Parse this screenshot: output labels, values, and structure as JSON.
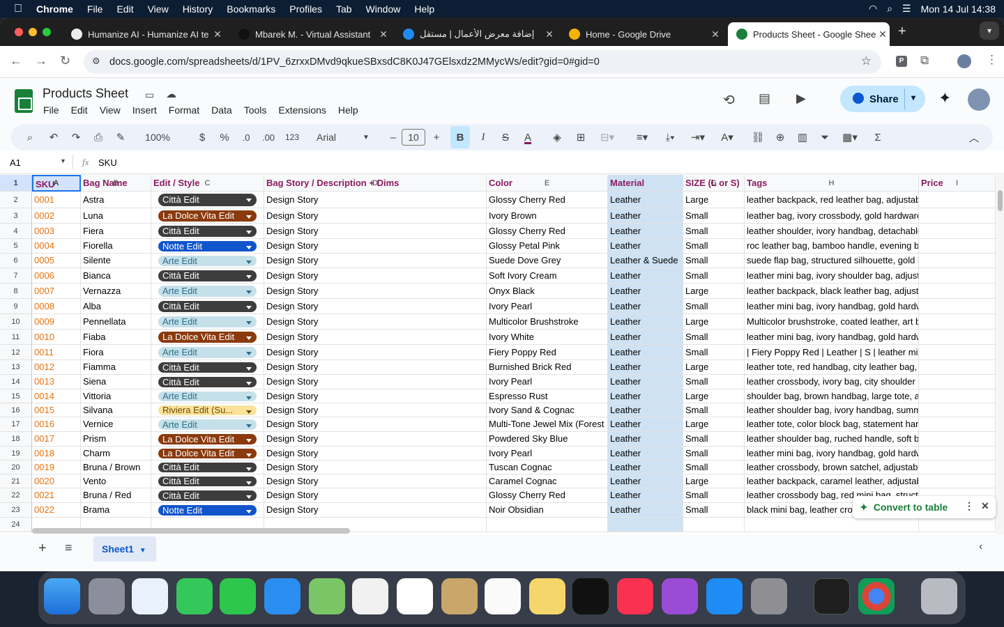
{
  "macos": {
    "menus": [
      "Chrome",
      "File",
      "Edit",
      "View",
      "History",
      "Bookmarks",
      "Profiles",
      "Tab",
      "Window",
      "Help"
    ],
    "clock": "Mon 14 Jul  14:38"
  },
  "browser": {
    "tabs": [
      {
        "title": "Humanize AI - Humanize AI te",
        "active": false
      },
      {
        "title": "Mbarek M. - Virtual Assistant",
        "active": false
      },
      {
        "title": "إضافة معرض الأعمال | مستقل",
        "active": false
      },
      {
        "title": "Home - Google Drive",
        "active": false
      },
      {
        "title": "Products Sheet - Google Shee",
        "active": true
      }
    ],
    "url": "docs.google.com/spreadsheets/d/1PV_6zrxxDMvd9qkueSBxsdC8K0J47GElsxdz2MMycWs/edit?gid=0#gid=0"
  },
  "sheets": {
    "title": "Products Sheet",
    "menu": [
      "File",
      "Edit",
      "View",
      "Insert",
      "Format",
      "Data",
      "Tools",
      "Extensions",
      "Help"
    ],
    "share_label": "Share",
    "zoom": "100%",
    "currency": "$",
    "percent": "%",
    "dec_minus": ".0",
    "dec_plus": ".00",
    "num_format": "123",
    "font": "Arial",
    "font_size": "10",
    "name_box": "A1",
    "formula": "SKU",
    "col_letters": [
      "A",
      "B",
      "C",
      "D",
      "E",
      "F",
      "G",
      "H",
      "I"
    ],
    "headers": [
      "SKU",
      "Bag Name",
      "Edit / Style",
      "Bag Story / Description + Dims",
      "Color",
      "Material",
      "SIZE (L or S)",
      "Tags",
      "Price"
    ],
    "row_numbers": [
      "1",
      "2",
      "3",
      "4",
      "5",
      "6",
      "7",
      "8",
      "9",
      "10",
      "11",
      "12",
      "13",
      "14",
      "15",
      "16",
      "17",
      "18",
      "19",
      "20",
      "21",
      "22",
      "23",
      "24"
    ],
    "rows": [
      {
        "sku": "0001",
        "name": "Astra",
        "edit": "Città Edit",
        "story": "Design Story",
        "color": "Glossy Cherry Red",
        "material": "Leather",
        "size": "Large",
        "tags": "leather backpack, red leather bag, adjustable strap, travel ba"
      },
      {
        "sku": "0002",
        "name": "Luna",
        "edit": "La Dolce Vita Edit",
        "story": "Design Story",
        "color": "Ivory Brown",
        "material": "Leather",
        "size": "Small",
        "tags": "leather bag, ivory crossbody, gold hardware, chain strap, city"
      },
      {
        "sku": "0003",
        "name": "Fiera",
        "edit": "Città Edit",
        "story": "Design Story",
        "color": "Glossy Cherry Red",
        "material": "Leather",
        "size": "Small",
        "tags": "leather shoulder, ivory handbag, detachable strap, structured"
      },
      {
        "sku": "0004",
        "name": "Fiorella",
        "edit": "Notte Edit",
        "story": "Design Story",
        "color": "Glossy Petal Pink",
        "material": "Leather",
        "size": "Small",
        "tags": "roc leather bag, bamboo handle, evening bag, pink handbag"
      },
      {
        "sku": "0005",
        "name": "Silente",
        "edit": "Arte Edit",
        "story": "Design Story",
        "color": "Suede Dove Grey",
        "material": "Leather & Suede",
        "size": "Small",
        "tags": "suede flap bag, structured silhouette, gold hardware, neutral"
      },
      {
        "sku": "0006",
        "name": "Bianca",
        "edit": "Città Edit",
        "story": "Design Story",
        "color": "Soft Ivory Cream",
        "material": "Leather",
        "size": "Small",
        "tags": "leather mini bag, ivory shoulder bag, adjustable strap, gold h"
      },
      {
        "sku": "0007",
        "name": "Vernazza",
        "edit": "Arte Edit",
        "story": "Design Story",
        "color": "Onyx Black",
        "material": "Leather",
        "size": "Large",
        "tags": "leather backpack, black leather bag, adjustable strap, gold ha"
      },
      {
        "sku": "0008",
        "name": "Alba",
        "edit": "Città Edit",
        "story": "Design Story",
        "color": "Ivory Pearl",
        "material": "Leather",
        "size": "Small",
        "tags": "leather mini bag, ivory handbag, gold hardware, crossbody c"
      },
      {
        "sku": "0009",
        "name": "Pennellata",
        "edit": "Arte Edit",
        "story": "Design Story",
        "color": "Multicolor Brushstroke",
        "material": "Leather",
        "size": "Large",
        "tags": "Multicolor brushstroke, coated leather, art backpack, gold ha"
      },
      {
        "sku": "0010",
        "name": "Fiaba",
        "edit": "La Dolce Vita Edit",
        "story": "Design Story",
        "color": "Ivory White",
        "material": "Leather",
        "size": "Small",
        "tags": "leather mini bag, ivory handbag, gold hardware, structured si"
      },
      {
        "sku": "0011",
        "name": "Fiora",
        "edit": "Arte Edit",
        "story": "Design Story",
        "color": "Fiery Poppy Red",
        "material": "Leather",
        "size": "Small",
        "tags": "| Fiery Poppy Red | Leather | S | leather mini bag, red handba"
      },
      {
        "sku": "0012",
        "name": "Fiamma",
        "edit": "Città Edit",
        "story": "Design Story",
        "color": "Burnished Brick Red",
        "material": "Leather",
        "size": "Large",
        "tags": "leather tote, red handbag, city leather bag, silver hardware, l"
      },
      {
        "sku": "0013",
        "name": "Siena",
        "edit": "Città Edit",
        "story": "Design Story",
        "color": " Ivory Pearl",
        "material": "Leather",
        "size": "Small",
        "tags": " leather crossbody, ivory bag, city shoulder bag, pebbled leat"
      },
      {
        "sku": "0014",
        "name": "Vittoria",
        "edit": "Arte Edit",
        "story": "Design Story",
        "color": "Espresso Rust",
        "material": "Leather",
        "size": "Large",
        "tags": "shoulder bag, brown handbag, large tote, antique hardware,"
      },
      {
        "sku": "0015",
        "name": "Silvana",
        "edit": "Riviera Edit (Su...",
        "story": "Design Story",
        "color": "Ivory Sand & Cognac",
        "material": "Leather",
        "size": "Small",
        "tags": "leather shoulder bag, ivory handbag, summer tones, adjustal"
      },
      {
        "sku": "0016",
        "name": "Vernice",
        "edit": "Arte Edit",
        "story": "Design Story",
        "color": "Multi-Tone Jewel Mix (Forest",
        "material": "Leather",
        "size": "Large",
        "tags": "leather tote, color block bag, statement handbag, made in Ita"
      },
      {
        "sku": "0017",
        "name": "Prism",
        "edit": "La Dolce Vita Edit",
        "story": "Design Story",
        "color": "Powdered Sky Blue",
        "material": "Leather",
        "size": "Small",
        "tags": "leather shoulder bag, ruched handle, soft blue handbag, mac"
      },
      {
        "sku": "0018",
        "name": "Charm",
        "edit": "La Dolce Vita Edit",
        "story": "Design Story",
        "color": "Ivory Pearl",
        "material": "Leather",
        "size": "Small",
        "tags": "leather mini bag, ivory handbag, gold hardware, top handle p"
      },
      {
        "sku": "0019",
        "name": "Bruna / Brown",
        "edit": "Città Edit",
        "story": "Design Story",
        "color": "Tuscan Cognac",
        "material": "Leather",
        "size": "Small",
        "tags": "leather crossbody, brown satchel, adjustable strap, made in I"
      },
      {
        "sku": "0020",
        "name": "Vento",
        "edit": "Città Edit",
        "story": "Design Story",
        "color": "Caramel Cognac",
        "material": "Leather",
        "size": "Large",
        "tags": "leather backpack, caramel leather, adjustable strap, city leath"
      },
      {
        "sku": "0021",
        "name": "Bruna / Red",
        "edit": "Città Edit",
        "story": "Design Story",
        "color": "Glossy Cherry Red",
        "material": "Leather",
        "size": "Small",
        "tags": "leather crossbody bag, red mini bag, structured silhouette, g"
      },
      {
        "sku": "0022",
        "name": "Brama",
        "edit": "Notte Edit",
        "story": "Design Story",
        "color": "Noir Obsidian",
        "material": "Leather",
        "size": "Small",
        "tags": "black mini bag, leather cro"
      }
    ],
    "chip_colors": {
      "Città Edit": {
        "bg": "#3d3d3d",
        "fg": "#ffffff"
      },
      "La Dolce Vita Edit": {
        "bg": "#8a3a0d",
        "fg": "#ffffff"
      },
      "Notte Edit": {
        "bg": "#1155cc",
        "fg": "#ffffff"
      },
      "Arte Edit": {
        "bg": "#c6e0ea",
        "fg": "#2a6f8a"
      },
      "Riviera Edit (Su...": {
        "bg": "#fde39a",
        "fg": "#6b4a05"
      }
    },
    "sheet_tab": "Sheet1",
    "toast": "Convert to table"
  }
}
